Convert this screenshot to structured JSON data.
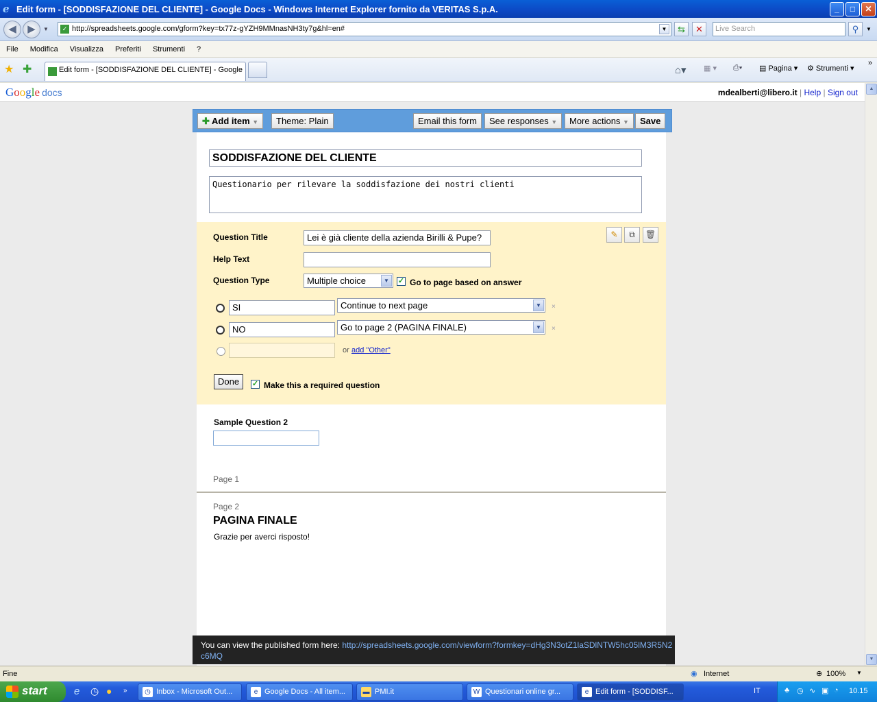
{
  "window": {
    "title": "Edit form - [SODDISFAZIONE DEL CLIENTE] - Google Docs - Windows Internet Explorer fornito da VERITAS S.p.A.",
    "minimize": "_",
    "maximize": "□",
    "close": "✕"
  },
  "address": {
    "url": "http://spreadsheets.google.com/gform?key=tx77z-gYZH9MMnasNH3ty7g&hl=en#",
    "search_placeholder": "Live Search"
  },
  "menu": [
    "File",
    "Modifica",
    "Visualizza",
    "Preferiti",
    "Strumenti",
    "?"
  ],
  "tab": {
    "label": "Edit form - [SODDISFAZIONE DEL CLIENTE] - Google ..."
  },
  "commandbar": {
    "page": "Pagina",
    "tools": "Strumenti"
  },
  "google": {
    "logo_letters": [
      "G",
      "o",
      "o",
      "g",
      "l",
      "e"
    ],
    "docs": "docs",
    "user": "mdealberti@libero.it",
    "sep": "|",
    "help": "Help",
    "signout": "Sign out"
  },
  "toolbar": {
    "add_item": "Add item",
    "theme": "Theme:  Plain",
    "email": "Email this form",
    "responses": "See responses",
    "more": "More actions",
    "save": "Save"
  },
  "form": {
    "title": "SODDISFAZIONE DEL CLIENTE",
    "description": "Questionario per rilevare la soddisfazione dei nostri clienti"
  },
  "question_editor": {
    "title_label": "Question Title",
    "title_value": "Lei è già cliente della azienda Birilli & Pupe?",
    "help_label": "Help Text",
    "help_value": "",
    "type_label": "Question Type",
    "type_value": "Multiple choice",
    "goto_label": "Go to page based on answer",
    "options": [
      {
        "value": "SI",
        "route": "Continue to next page"
      },
      {
        "value": "NO",
        "route": "Go to page 2 (PAGINA FINALE)"
      }
    ],
    "remove": "×",
    "other_or": "or",
    "add_other": "add \"Other\"",
    "done": "Done",
    "required_label": "Make this a required question"
  },
  "sample": {
    "label": "Sample Question 2"
  },
  "pages": {
    "page1": "Page 1",
    "page2": "Page 2",
    "page2_title": "PAGINA FINALE",
    "page2_text": "Grazie per averci risposto!"
  },
  "banner": {
    "text": "You can view the published form here:",
    "link": "http://spreadsheets.google.com/viewform?formkey=dHg3N3otZ1laSDlNTW5hc05lM3R5N2c6MQ"
  },
  "status": {
    "left": "Fine",
    "zone": "Internet",
    "zoom": "100%"
  },
  "taskbar": {
    "start": "start",
    "tasks": [
      "Inbox - Microsoft Out...",
      "Google Docs - All item...",
      "PMI.it",
      "Questionari online gr...",
      "Edit form - [SODDISF..."
    ],
    "lang": "IT",
    "clock": "10.15"
  },
  "colors": {
    "title_blue": "#0c48c4",
    "toolbar_blue": "#5f9ddc",
    "editor_yellow": "#fff3c9",
    "banner_dark": "#232323",
    "link_blue": "#1122cc"
  }
}
